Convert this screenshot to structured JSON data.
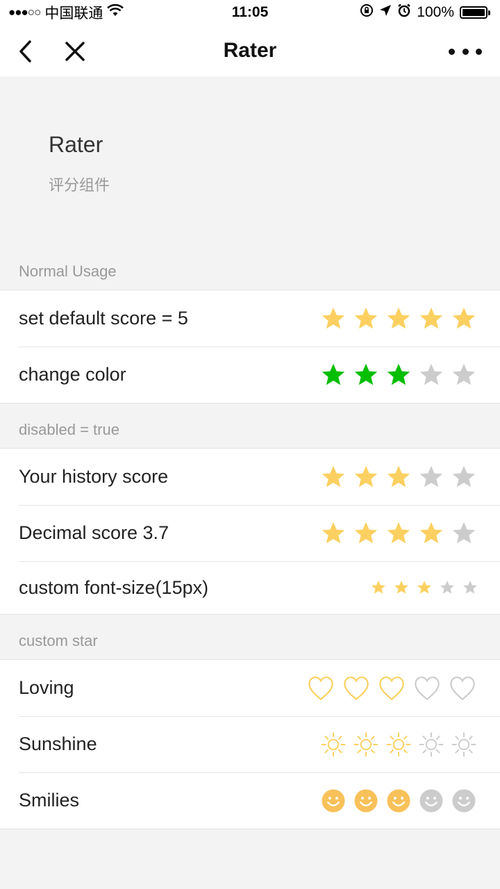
{
  "status_bar": {
    "signal": "●●●○○",
    "carrier": "中国联通",
    "time": "11:05",
    "battery": "100%"
  },
  "nav": {
    "title": "Rater"
  },
  "header": {
    "title": "Rater",
    "subtitle": "评分组件"
  },
  "colors": {
    "active_yellow": "#fcd060",
    "active_green": "#04be02",
    "inactive": "#cccccc",
    "smile_yellow": "#f8c15a"
  },
  "sections": [
    {
      "title": "Normal Usage",
      "rows": [
        {
          "label": "set default score = 5",
          "icon": "star-icon",
          "score": 5,
          "max": 5,
          "color": "#fcd060"
        },
        {
          "label": "change color",
          "icon": "star-icon",
          "score": 3,
          "max": 5,
          "color": "#04be02"
        }
      ]
    },
    {
      "title": "disabled = true",
      "rows": [
        {
          "label": "Your history score",
          "icon": "star-icon",
          "score": 3,
          "max": 5,
          "color": "#fcd060"
        },
        {
          "label": "Decimal score 3.7",
          "icon": "star-icon",
          "score": 4,
          "max": 5,
          "color": "#fcd060"
        },
        {
          "label": "custom font-size(15px)",
          "icon": "star-icon",
          "score": 3,
          "max": 5,
          "color": "#fcd060",
          "small": true
        }
      ]
    },
    {
      "title": "custom star",
      "rows": [
        {
          "label": "Loving",
          "icon": "heart-icon",
          "score": 3,
          "max": 5,
          "color": "#fcd060"
        },
        {
          "label": "Sunshine",
          "icon": "sun-icon",
          "score": 3,
          "max": 5,
          "color": "#fcd060"
        },
        {
          "label": "Smilies",
          "icon": "smiley-icon",
          "score": 3,
          "max": 5,
          "color": "#f8c15a"
        }
      ]
    }
  ]
}
